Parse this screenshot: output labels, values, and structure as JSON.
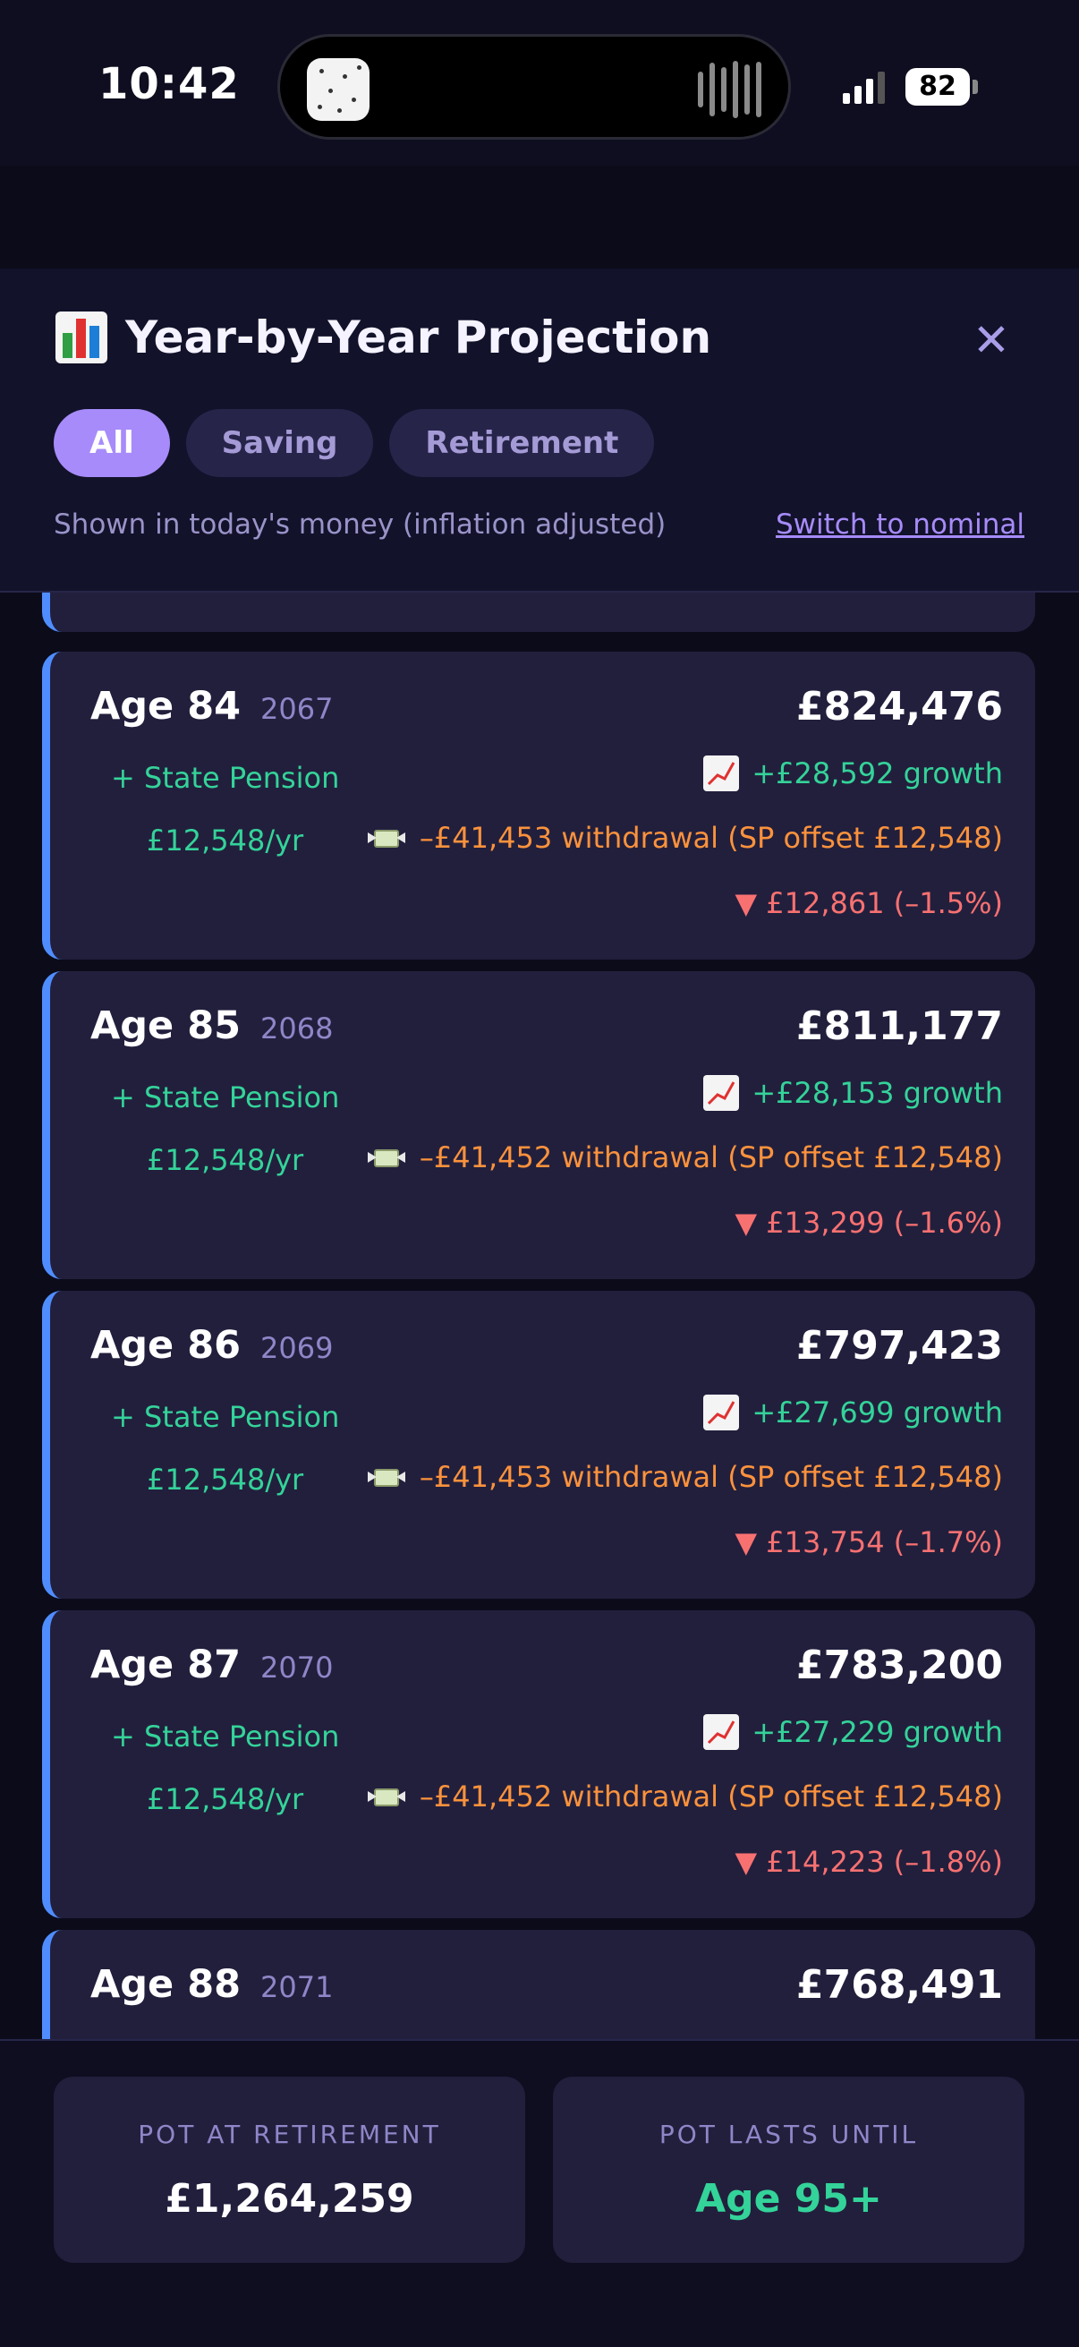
{
  "status_bar": {
    "time": "10:42",
    "battery": "82"
  },
  "header": {
    "title": "Year-by-Year Projection",
    "close_symbol": "✕",
    "filters": [
      {
        "label": "All",
        "active": true
      },
      {
        "label": "Saving",
        "active": false
      },
      {
        "label": "Retirement",
        "active": false
      }
    ],
    "note": "Shown in today's money (inflation adjusted)",
    "switch_link": "Switch to nominal"
  },
  "rows": [
    {
      "age": "Age 84",
      "year": "2067",
      "pot": "£824,476",
      "state_pension_label": "+ State Pension",
      "state_pension_amount": "£12,548/yr",
      "growth": "+£28,592 growth",
      "withdrawal": "–£41,453 withdrawal (SP offset £12,548)",
      "change": "▼ £12,861 (–1.5%)"
    },
    {
      "age": "Age 85",
      "year": "2068",
      "pot": "£811,177",
      "state_pension_label": "+ State Pension",
      "state_pension_amount": "£12,548/yr",
      "growth": "+£28,153 growth",
      "withdrawal": "–£41,452 withdrawal (SP offset £12,548)",
      "change": "▼ £13,299 (–1.6%)"
    },
    {
      "age": "Age 86",
      "year": "2069",
      "pot": "£797,423",
      "state_pension_label": "+ State Pension",
      "state_pension_amount": "£12,548/yr",
      "growth": "+£27,699 growth",
      "withdrawal": "–£41,453 withdrawal (SP offset £12,548)",
      "change": "▼ £13,754 (–1.7%)"
    },
    {
      "age": "Age 87",
      "year": "2070",
      "pot": "£783,200",
      "state_pension_label": "+ State Pension",
      "state_pension_amount": "£12,548/yr",
      "growth": "+£27,229 growth",
      "withdrawal": "–£41,452 withdrawal (SP offset £12,548)",
      "change": "▼ £14,223 (–1.8%)"
    },
    {
      "age": "Age 88",
      "year": "2071",
      "pot": "£768,491"
    }
  ],
  "footer": {
    "pot_at_retirement_label": "POT AT RETIREMENT",
    "pot_at_retirement_value": "£1,264,259",
    "pot_lasts_label": "POT LASTS UNTIL",
    "pot_lasts_value": "Age 95+"
  },
  "colors": {
    "accent": "#a78bfa",
    "growth": "#34d399",
    "withdrawal": "#fb923c",
    "decline": "#f87171",
    "card_border": "#4f8dff"
  }
}
